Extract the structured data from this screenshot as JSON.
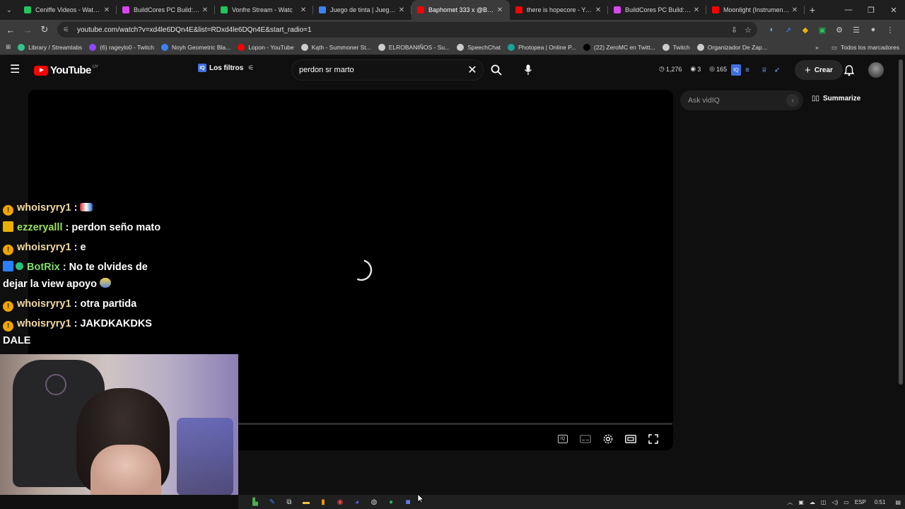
{
  "browser": {
    "tabs": [
      {
        "title": "Ceniffe Videos - Watch Or",
        "color": "#22c55e",
        "active": false
      },
      {
        "title": "BuildCores PC Build: New",
        "color": "#d946ef",
        "active": false
      },
      {
        "title": "Vonfre Stream - Watc",
        "color": "#22c55e",
        "active": false
      },
      {
        "title": "Juego de tinta | Juega en",
        "color": "#3b82f6",
        "active": false
      },
      {
        "title": "Baphomet 333 x @BoHen",
        "color": "#ff0000",
        "active": true
      },
      {
        "title": "there is hopecore - YouTu",
        "color": "#ff0000",
        "active": false
      },
      {
        "title": "BuildCores PC Build: New",
        "color": "#d946ef",
        "active": false
      },
      {
        "title": "Moonlight (Instrumental)",
        "color": "#ff0000",
        "active": false
      }
    ],
    "url": "youtube.com/watch?v=xd4le6DQn4E&list=RDxd4le6DQn4E&start_radio=1",
    "bookmarks": [
      {
        "label": "Library / Streamlabs",
        "color": "#31c48d"
      },
      {
        "label": "(6) rageylo0 - Twitch",
        "color": "#9146ff"
      },
      {
        "label": "Noyh Geometric Bla...",
        "color": "#3b82f6"
      },
      {
        "label": "Lopon - YouTube",
        "color": "#ff0000"
      },
      {
        "label": "Kąth - Summoner St...",
        "color": "#cccccc"
      },
      {
        "label": "ELROBANIÑOS - Su...",
        "color": "#cccccc"
      },
      {
        "label": "SpeechChat",
        "color": "#cccccc"
      },
      {
        "label": "Photopea | Online P...",
        "color": "#18a497"
      },
      {
        "label": "(22) ZeroMC en Twitt...",
        "color": "#000000"
      },
      {
        "label": "Twitch",
        "color": "#cccccc"
      },
      {
        "label": "Organizador De Zap...",
        "color": "#cccccc"
      }
    ],
    "all_bookmarks": "Todos los marcadores"
  },
  "youtube": {
    "logo_text": "YouTube",
    "country": "UY",
    "filters_label": "Los filtros",
    "search_query": "perdon sr marto",
    "stats": {
      "views": "1,276",
      "eyes": "3",
      "watch": "165"
    },
    "create_label": "Crear"
  },
  "vidiq": {
    "ask_placeholder": "Ask vidIQ",
    "summarize_label": "Summarize"
  },
  "chat": [
    {
      "badge": "orange",
      "user": "whoisryry1",
      "user_class": "name-y",
      "text": " : ",
      "emote": true
    },
    {
      "badge": "crown",
      "user": "ezzeryalll",
      "user_class": "name-g",
      "text": " : perdon seño mato"
    },
    {
      "badge": "orange",
      "user": "whoisryry1",
      "user_class": "name-y",
      "text": " : e"
    },
    {
      "badge": "bot",
      "user": "BotRix",
      "user_class": "name-bot",
      "text": " : No te olvides de dejar la view apoyo",
      "emote2": true
    },
    {
      "badge": "orange",
      "user": "whoisryry1",
      "user_class": "name-y",
      "text": " : otra partida"
    },
    {
      "badge": "orange",
      "user": "whoisryry1",
      "user_class": "name-y",
      "text": " : JAKDKAKDKS DALE"
    }
  ],
  "taskbar": {
    "lang": "ESP",
    "time": "0:51"
  },
  "colors": {
    "yt_red": "#ff0000",
    "bg": "#0f0f0f",
    "vidiq_blue": "#3f6fe0"
  }
}
